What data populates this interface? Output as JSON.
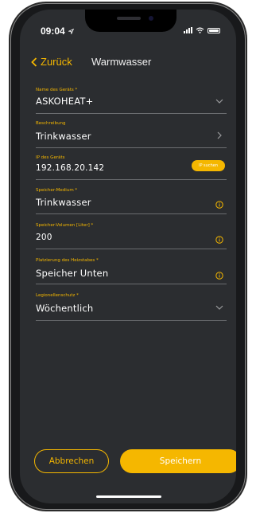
{
  "status_bar": {
    "time": "09:04"
  },
  "nav": {
    "back_label": "Zurück",
    "title": "Warmwasser"
  },
  "form": {
    "fields": [
      {
        "label": "Name des Geräts *",
        "value": "ASKOHEAT+"
      },
      {
        "label": "Beschreibung",
        "value": "Trinkwasser"
      },
      {
        "label": "IP des Geräts",
        "value": "192.168.20.142",
        "button": "IP suchen"
      },
      {
        "label": "Speicher-Medium *",
        "value": "Trinkwasser"
      },
      {
        "label": "Speicher-Volumen [Liter] *",
        "value": "200"
      },
      {
        "label": "Platzierung des Heizstabes *",
        "value": "Speicher Unten"
      },
      {
        "label": "Legionellenschutz *",
        "value": "Wöchentlich"
      }
    ]
  },
  "footer": {
    "cancel_label": "Abbrechen",
    "save_label": "Speichern"
  },
  "colors": {
    "accent": "#f5b700",
    "background": "#2b2d30",
    "text": "#ffffff"
  },
  "icons": {
    "dropdown": "chevron-down-icon",
    "navigate": "chevron-right-icon",
    "info": "info-icon"
  }
}
